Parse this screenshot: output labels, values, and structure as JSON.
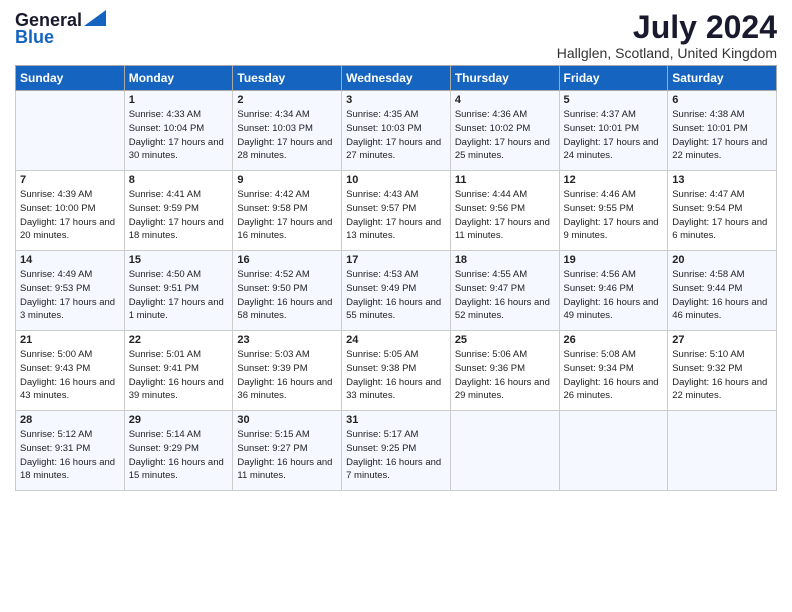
{
  "logo": {
    "general": "General",
    "blue": "Blue"
  },
  "title": "July 2024",
  "location": "Hallglen, Scotland, United Kingdom",
  "days_of_week": [
    "Sunday",
    "Monday",
    "Tuesday",
    "Wednesday",
    "Thursday",
    "Friday",
    "Saturday"
  ],
  "weeks": [
    [
      {
        "day": "",
        "sunrise": "",
        "sunset": "",
        "daylight": ""
      },
      {
        "day": "1",
        "sunrise": "Sunrise: 4:33 AM",
        "sunset": "Sunset: 10:04 PM",
        "daylight": "Daylight: 17 hours and 30 minutes."
      },
      {
        "day": "2",
        "sunrise": "Sunrise: 4:34 AM",
        "sunset": "Sunset: 10:03 PM",
        "daylight": "Daylight: 17 hours and 28 minutes."
      },
      {
        "day": "3",
        "sunrise": "Sunrise: 4:35 AM",
        "sunset": "Sunset: 10:03 PM",
        "daylight": "Daylight: 17 hours and 27 minutes."
      },
      {
        "day": "4",
        "sunrise": "Sunrise: 4:36 AM",
        "sunset": "Sunset: 10:02 PM",
        "daylight": "Daylight: 17 hours and 25 minutes."
      },
      {
        "day": "5",
        "sunrise": "Sunrise: 4:37 AM",
        "sunset": "Sunset: 10:01 PM",
        "daylight": "Daylight: 17 hours and 24 minutes."
      },
      {
        "day": "6",
        "sunrise": "Sunrise: 4:38 AM",
        "sunset": "Sunset: 10:01 PM",
        "daylight": "Daylight: 17 hours and 22 minutes."
      }
    ],
    [
      {
        "day": "7",
        "sunrise": "Sunrise: 4:39 AM",
        "sunset": "Sunset: 10:00 PM",
        "daylight": "Daylight: 17 hours and 20 minutes."
      },
      {
        "day": "8",
        "sunrise": "Sunrise: 4:41 AM",
        "sunset": "Sunset: 9:59 PM",
        "daylight": "Daylight: 17 hours and 18 minutes."
      },
      {
        "day": "9",
        "sunrise": "Sunrise: 4:42 AM",
        "sunset": "Sunset: 9:58 PM",
        "daylight": "Daylight: 17 hours and 16 minutes."
      },
      {
        "day": "10",
        "sunrise": "Sunrise: 4:43 AM",
        "sunset": "Sunset: 9:57 PM",
        "daylight": "Daylight: 17 hours and 13 minutes."
      },
      {
        "day": "11",
        "sunrise": "Sunrise: 4:44 AM",
        "sunset": "Sunset: 9:56 PM",
        "daylight": "Daylight: 17 hours and 11 minutes."
      },
      {
        "day": "12",
        "sunrise": "Sunrise: 4:46 AM",
        "sunset": "Sunset: 9:55 PM",
        "daylight": "Daylight: 17 hours and 9 minutes."
      },
      {
        "day": "13",
        "sunrise": "Sunrise: 4:47 AM",
        "sunset": "Sunset: 9:54 PM",
        "daylight": "Daylight: 17 hours and 6 minutes."
      }
    ],
    [
      {
        "day": "14",
        "sunrise": "Sunrise: 4:49 AM",
        "sunset": "Sunset: 9:53 PM",
        "daylight": "Daylight: 17 hours and 3 minutes."
      },
      {
        "day": "15",
        "sunrise": "Sunrise: 4:50 AM",
        "sunset": "Sunset: 9:51 PM",
        "daylight": "Daylight: 17 hours and 1 minute."
      },
      {
        "day": "16",
        "sunrise": "Sunrise: 4:52 AM",
        "sunset": "Sunset: 9:50 PM",
        "daylight": "Daylight: 16 hours and 58 minutes."
      },
      {
        "day": "17",
        "sunrise": "Sunrise: 4:53 AM",
        "sunset": "Sunset: 9:49 PM",
        "daylight": "Daylight: 16 hours and 55 minutes."
      },
      {
        "day": "18",
        "sunrise": "Sunrise: 4:55 AM",
        "sunset": "Sunset: 9:47 PM",
        "daylight": "Daylight: 16 hours and 52 minutes."
      },
      {
        "day": "19",
        "sunrise": "Sunrise: 4:56 AM",
        "sunset": "Sunset: 9:46 PM",
        "daylight": "Daylight: 16 hours and 49 minutes."
      },
      {
        "day": "20",
        "sunrise": "Sunrise: 4:58 AM",
        "sunset": "Sunset: 9:44 PM",
        "daylight": "Daylight: 16 hours and 46 minutes."
      }
    ],
    [
      {
        "day": "21",
        "sunrise": "Sunrise: 5:00 AM",
        "sunset": "Sunset: 9:43 PM",
        "daylight": "Daylight: 16 hours and 43 minutes."
      },
      {
        "day": "22",
        "sunrise": "Sunrise: 5:01 AM",
        "sunset": "Sunset: 9:41 PM",
        "daylight": "Daylight: 16 hours and 39 minutes."
      },
      {
        "day": "23",
        "sunrise": "Sunrise: 5:03 AM",
        "sunset": "Sunset: 9:39 PM",
        "daylight": "Daylight: 16 hours and 36 minutes."
      },
      {
        "day": "24",
        "sunrise": "Sunrise: 5:05 AM",
        "sunset": "Sunset: 9:38 PM",
        "daylight": "Daylight: 16 hours and 33 minutes."
      },
      {
        "day": "25",
        "sunrise": "Sunrise: 5:06 AM",
        "sunset": "Sunset: 9:36 PM",
        "daylight": "Daylight: 16 hours and 29 minutes."
      },
      {
        "day": "26",
        "sunrise": "Sunrise: 5:08 AM",
        "sunset": "Sunset: 9:34 PM",
        "daylight": "Daylight: 16 hours and 26 minutes."
      },
      {
        "day": "27",
        "sunrise": "Sunrise: 5:10 AM",
        "sunset": "Sunset: 9:32 PM",
        "daylight": "Daylight: 16 hours and 22 minutes."
      }
    ],
    [
      {
        "day": "28",
        "sunrise": "Sunrise: 5:12 AM",
        "sunset": "Sunset: 9:31 PM",
        "daylight": "Daylight: 16 hours and 18 minutes."
      },
      {
        "day": "29",
        "sunrise": "Sunrise: 5:14 AM",
        "sunset": "Sunset: 9:29 PM",
        "daylight": "Daylight: 16 hours and 15 minutes."
      },
      {
        "day": "30",
        "sunrise": "Sunrise: 5:15 AM",
        "sunset": "Sunset: 9:27 PM",
        "daylight": "Daylight: 16 hours and 11 minutes."
      },
      {
        "day": "31",
        "sunrise": "Sunrise: 5:17 AM",
        "sunset": "Sunset: 9:25 PM",
        "daylight": "Daylight: 16 hours and 7 minutes."
      },
      {
        "day": "",
        "sunrise": "",
        "sunset": "",
        "daylight": ""
      },
      {
        "day": "",
        "sunrise": "",
        "sunset": "",
        "daylight": ""
      },
      {
        "day": "",
        "sunrise": "",
        "sunset": "",
        "daylight": ""
      }
    ]
  ]
}
